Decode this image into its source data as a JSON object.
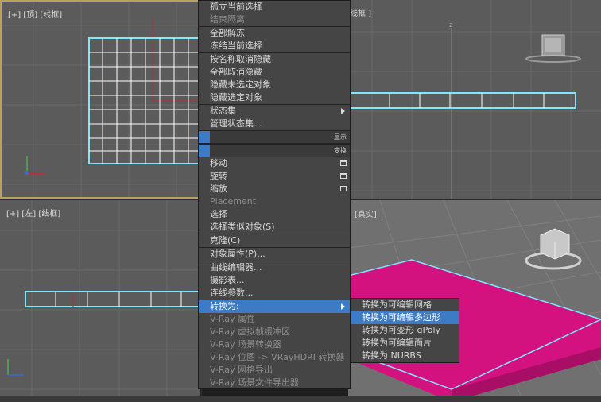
{
  "viewports": {
    "top": {
      "label": "[+] [顶] [线框]"
    },
    "front": {
      "label": "线框 ]",
      "axis_label": "z"
    },
    "left": {
      "label": "[+] [左] [线框]"
    },
    "persp": {
      "label": "[真实]"
    }
  },
  "quad_menu": {
    "items_top": [
      {
        "label": "孤立当前选择",
        "enabled": true
      },
      {
        "label": "结束隔离",
        "enabled": false
      }
    ],
    "items_freeze": [
      {
        "label": "全部解冻",
        "enabled": true
      },
      {
        "label": "冻结当前选择",
        "enabled": true
      }
    ],
    "items_hide": [
      {
        "label": "按名称取消隐藏",
        "enabled": true
      },
      {
        "label": "全部取消隐藏",
        "enabled": true
      },
      {
        "label": "隐藏未选定对象",
        "enabled": true
      },
      {
        "label": "隐藏选定对象",
        "enabled": true
      }
    ],
    "items_state": [
      {
        "label": "状态集",
        "enabled": true,
        "submenu": true
      },
      {
        "label": "管理状态集...",
        "enabled": true
      }
    ],
    "quad_display_title": "显示",
    "quad_transform_title": "变换",
    "items_transform": [
      {
        "label": "移动",
        "enabled": true,
        "box": true
      },
      {
        "label": "旋转",
        "enabled": true,
        "box": true
      },
      {
        "label": "缩放",
        "enabled": true,
        "box": true
      },
      {
        "label": "Placement",
        "enabled": false
      },
      {
        "label": "选择",
        "enabled": true
      },
      {
        "label": "选择类似对象(S)",
        "enabled": true
      }
    ],
    "clone_label": "克隆(C)",
    "props_label": "对象属性(P)...",
    "items_editors": [
      {
        "label": "曲线编辑器...",
        "enabled": true
      },
      {
        "label": "摄影表...",
        "enabled": true
      },
      {
        "label": "连线参数...",
        "enabled": true
      }
    ],
    "convert_label": "转换为:",
    "items_vray": [
      {
        "label": "V-Ray 属性",
        "enabled": false
      },
      {
        "label": "V-Ray 虚拟帧缓冲区",
        "enabled": false
      },
      {
        "label": "V-Ray 场景转换器",
        "enabled": false
      },
      {
        "label": "V-Ray 位图 -> VRayHDRI 转换器",
        "enabled": false
      },
      {
        "label": "V-Ray 网格导出",
        "enabled": false
      },
      {
        "label": "V-Ray 场景文件导出器",
        "enabled": false
      }
    ]
  },
  "convert_submenu": [
    {
      "label": "转换为可编辑网格",
      "highlight": false
    },
    {
      "label": "转换为可编辑多边形",
      "highlight": true
    },
    {
      "label": "转换为可变形 gPoly",
      "highlight": false
    },
    {
      "label": "转换为可编辑面片",
      "highlight": false
    },
    {
      "label": "转换为 NURBS",
      "highlight": false
    }
  ],
  "colors": {
    "highlight": "#3d7bc4",
    "object_magenta": "#d4127f",
    "selection_outline": "#7fe6ff",
    "active_viewport_border": "#b9a25b"
  }
}
